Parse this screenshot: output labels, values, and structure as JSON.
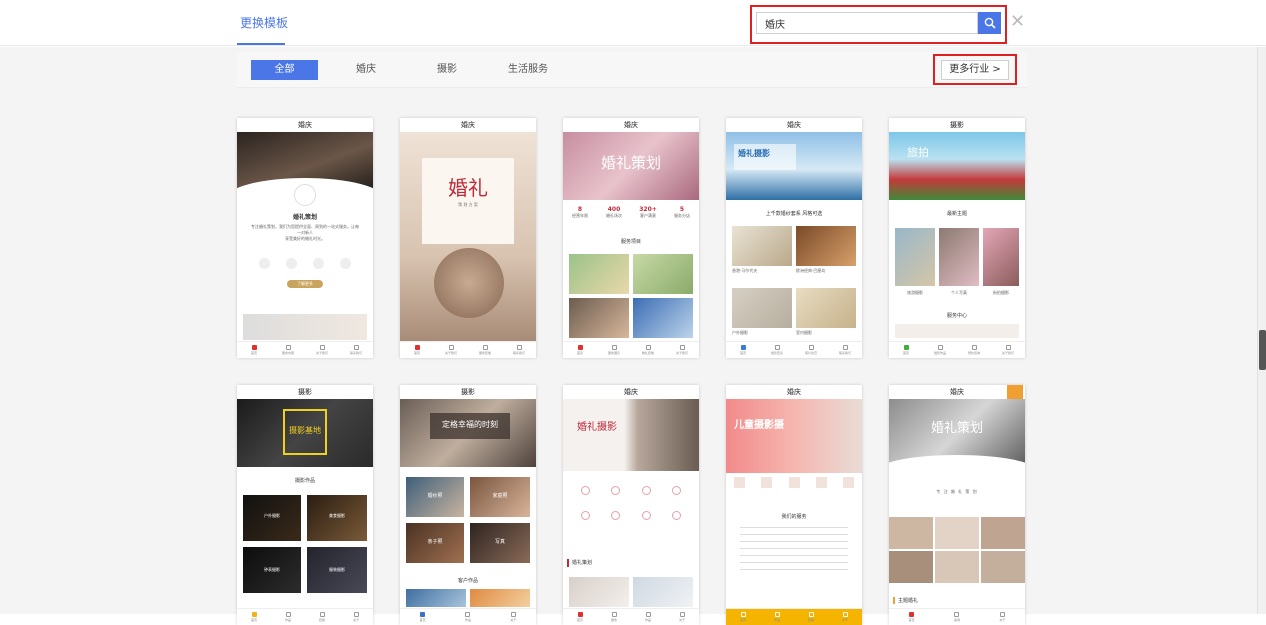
{
  "header": {
    "tab_label": "更换模板",
    "search_value": "婚庆"
  },
  "filters": {
    "tabs": [
      {
        "label": "全部",
        "active": true
      },
      {
        "label": "婚庆",
        "active": false
      },
      {
        "label": "摄影",
        "active": false
      },
      {
        "label": "生活服务",
        "active": false
      }
    ],
    "more_label": "更多行业 >"
  },
  "templates": [
    {
      "category": "婚庆",
      "theme": "dark-wedding",
      "title": "婚礼策划",
      "lines": [
        "专注婚礼策划，我们为您提供全面、周到的一站式服务，让每一对新人",
        "享受美好的婚礼时光。"
      ],
      "btn": "了解更多",
      "bottom": [
        "首页",
        "服务内容",
        "关于我们",
        "联系我们"
      ]
    },
    {
      "category": "婚庆",
      "theme": "beige-wedding",
      "title": "婚礼",
      "sub": "策 划 方 案",
      "bottom": [
        "首页",
        "关于我们",
        "服务套餐",
        "联系我们"
      ]
    },
    {
      "category": "婚庆",
      "theme": "pink-plan",
      "title": "婚礼策划",
      "stats": [
        {
          "v": "8",
          "t": "经营年限"
        },
        {
          "v": "400",
          "t": "婚礼场次"
        },
        {
          "v": "320+",
          "t": "客户满意"
        },
        {
          "v": "5",
          "t": "服务分店"
        }
      ],
      "section": "服务项目",
      "bottom": [
        "首页",
        "服务展示",
        "婚礼套餐",
        "关于我们"
      ]
    },
    {
      "category": "婚庆",
      "theme": "beach-photo",
      "title": "婚礼摄影",
      "section": "上千款婚纱套系 风格可选",
      "items": [
        "香港·马尔代夫",
        "欧洲经典·巴厘岛",
        "户外摄影",
        "室内摄影"
      ],
      "bottom": [
        "首页",
        "摄影套系",
        "客片欣赏",
        "联系我们"
      ]
    },
    {
      "category": "摄影",
      "theme": "tulip-photo",
      "title": "旅拍",
      "section": "最新主题",
      "items": [
        "旅游摄影",
        "个人写真",
        "街拍摄影"
      ],
      "section2": "服务中心",
      "bottom": [
        "首页",
        "摄影作品",
        "预约咨询",
        "关于我们"
      ]
    },
    {
      "category": "摄影",
      "theme": "studio-dark",
      "title": "摄影基地",
      "section": "摄影作品",
      "items": [
        "户外摄影",
        "美食摄影",
        "钟表摄影",
        "服装摄影"
      ],
      "bottom": [
        "首页",
        "作品",
        "套餐",
        "关于"
      ]
    },
    {
      "category": "摄影",
      "theme": "happy-moment",
      "title": "定格幸福的时刻",
      "items": [
        "婚纱照",
        "家庭照",
        "亲子照",
        "写真"
      ],
      "section": "客户作品",
      "bottom": [
        "首页",
        "作品",
        "关于"
      ]
    },
    {
      "category": "婚庆",
      "theme": "white-wedding",
      "title": "婚礼摄影",
      "section": "婚礼策划",
      "bottom": [
        "首页",
        "服务",
        "作品",
        "关于"
      ]
    },
    {
      "category": "婚庆",
      "theme": "kids-photo",
      "title": "儿童摄影摄",
      "section": "我们的服务",
      "bottom": [
        "首页",
        "作品",
        "套餐",
        "关于"
      ]
    },
    {
      "category": "婚庆",
      "theme": "bw-plan",
      "title": "婚礼策划",
      "sub": "专 注 婚 礼 策 划",
      "section": "主题婚礼",
      "bottom": [
        "首页",
        "案例",
        "关于"
      ]
    }
  ]
}
